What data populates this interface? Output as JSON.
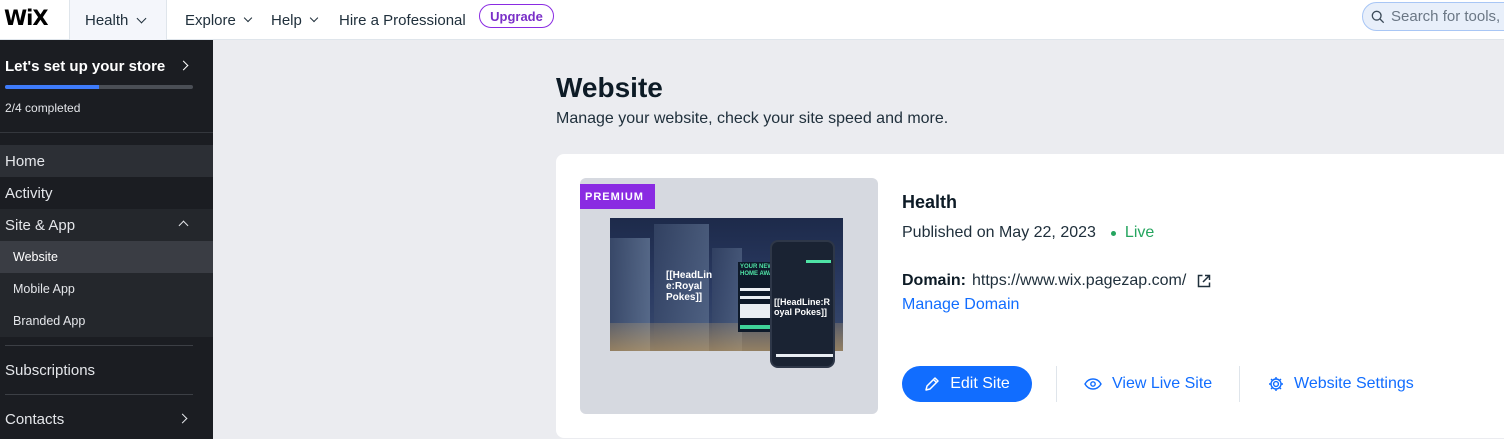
{
  "topbar": {
    "logo": "WiX",
    "site_switcher": "Health",
    "nav": [
      "Explore",
      "Help",
      "Hire a Professional"
    ],
    "upgrade_label": "Upgrade",
    "search_placeholder": "Search for tools, a"
  },
  "sidebar": {
    "setup_title": "Let's set up your store",
    "setup_progress": 0.5,
    "setup_count": "2/4 completed",
    "items": {
      "home": "Home",
      "activity": "Activity",
      "site_app": "Site & App",
      "website": "Website",
      "mobile_app": "Mobile App",
      "branded_app": "Branded App",
      "subscriptions": "Subscriptions",
      "contacts": "Contacts"
    }
  },
  "main": {
    "title": "Website",
    "subtitle": "Manage your website, check your site speed and more.",
    "card": {
      "badge": "PREMIUM",
      "preview_headline": "[[HeadLin e:Royal Pokes]]",
      "preview_mobile_headline": "[[HeadLine:R oyal Pokes]]",
      "preview_form_title": "YOUR NEW HOME AWA",
      "site_name": "Health",
      "published": "Published on May 22, 2023",
      "status": "Live",
      "domain_label": "Domain:",
      "domain_url": "https://www.wix.pagezap.com/",
      "manage_domain": "Manage Domain",
      "edit_site": "Edit Site",
      "view_live": "View Live Site",
      "settings": "Website Settings"
    }
  },
  "colors": {
    "accent": "#116dff",
    "premium": "#8a2be2",
    "live": "#25a55f",
    "sidebar_bg": "#1b1d22"
  }
}
